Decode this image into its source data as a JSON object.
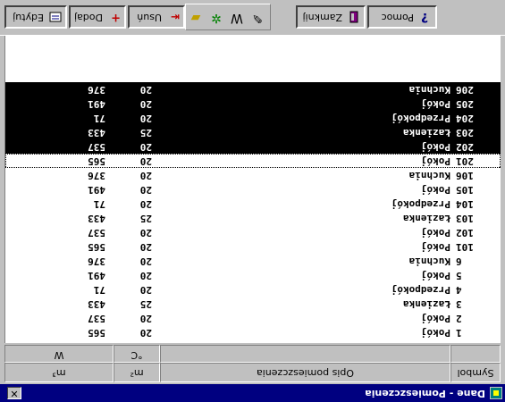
{
  "window": {
    "title": "Dane - Pomieszczenia",
    "close_glyph": "✕"
  },
  "toolbar": {
    "edit_label": "Edytuj",
    "add_label": "Dodaj",
    "delete_label": "Usuń",
    "close_label": "Zamknij",
    "help_label": "Pomoc",
    "help_glyph": "?",
    "tool_icons": [
      "folder-icon",
      "tools-icon",
      "w-icon",
      "brush-icon"
    ],
    "tool_glyphs": [
      "▰",
      "✲",
      "W",
      "✎"
    ]
  },
  "columns": {
    "symbol": "Symbol",
    "description": "Opis pomieszczenia",
    "m2": "m²",
    "m3": "m³",
    "unit_m2": "°C",
    "unit_m3": "W"
  },
  "rows": [
    {
      "symbol": "1",
      "description": "Pokój",
      "m2": "20",
      "m3": "565"
    },
    {
      "symbol": "2",
      "description": "Pokój",
      "m2": "20",
      "m3": "537"
    },
    {
      "symbol": "3",
      "description": "Łazienka",
      "m2": "25",
      "m3": "433"
    },
    {
      "symbol": "4",
      "description": "Przedpokój",
      "m2": "20",
      "m3": "71"
    },
    {
      "symbol": "5",
      "description": "Pokój",
      "m2": "20",
      "m3": "491"
    },
    {
      "symbol": "6",
      "description": "Kuchnia",
      "m2": "20",
      "m3": "376"
    },
    {
      "symbol": "101",
      "description": "Pokój",
      "m2": "20",
      "m3": "565"
    },
    {
      "symbol": "102",
      "description": "Pokój",
      "m2": "20",
      "m3": "537"
    },
    {
      "symbol": "103",
      "description": "Łazienka",
      "m2": "25",
      "m3": "433"
    },
    {
      "symbol": "104",
      "description": "Przedpokój",
      "m2": "20",
      "m3": "71"
    },
    {
      "symbol": "105",
      "description": "Pokój",
      "m2": "20",
      "m3": "491"
    },
    {
      "symbol": "106",
      "description": "Kuchnia",
      "m2": "20",
      "m3": "376"
    },
    {
      "symbol": "201",
      "description": "Pokój",
      "m2": "20",
      "m3": "565"
    },
    {
      "symbol": "202",
      "description": "Pokój",
      "m2": "20",
      "m3": "537"
    },
    {
      "symbol": "203",
      "description": "Łazienka",
      "m2": "25",
      "m3": "433"
    },
    {
      "symbol": "204",
      "description": "Przedpokój",
      "m2": "20",
      "m3": "71"
    },
    {
      "symbol": "205",
      "description": "Pokój",
      "m2": "20",
      "m3": "491"
    },
    {
      "symbol": "206",
      "description": "Kuchnia",
      "m2": "20",
      "m3": "376"
    }
  ],
  "selected_symbols": [
    "202",
    "203",
    "204",
    "205",
    "206"
  ],
  "focused_symbol": "201",
  "colors": {
    "title_bar": "#000080",
    "selection": "#000000",
    "face": "#c0c0c0"
  }
}
